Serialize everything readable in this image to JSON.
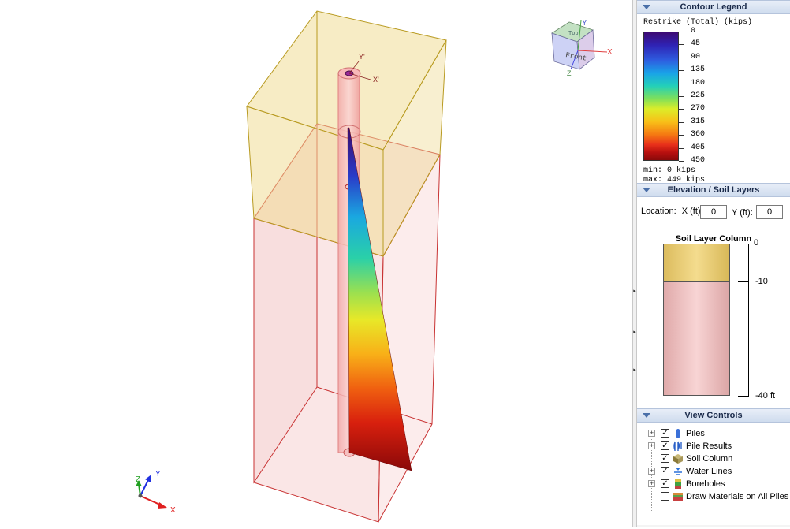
{
  "viewport": {
    "axis_labels": {
      "x": "X",
      "y": "Y",
      "z": "Z"
    },
    "pile_labels": {
      "x_prime": "X'",
      "y_prime": "Y'"
    },
    "view_cube": {
      "face": "Front",
      "top": "Top",
      "x": "X",
      "y": "Y",
      "z": "Z"
    },
    "colors": {
      "upper_soil": "#f0dc96",
      "lower_soil": "#f5c8c8",
      "pile": "#f4a0a0",
      "edge_upper": "#b89a20",
      "edge_lower": "#c83232"
    }
  },
  "contour_legend": {
    "header": "Contour Legend",
    "title": "Restrike (Total) (kips)",
    "ticks": [
      "0",
      "45",
      "90",
      "135",
      "180",
      "225",
      "270",
      "315",
      "360",
      "405",
      "450"
    ],
    "min_text": "min: 0 kips",
    "max_text": "max: 449 kips"
  },
  "elevation": {
    "header": "Elevation / Soil Layers",
    "location_label": "Location:",
    "x_label": "X (ft):",
    "x_value": "0",
    "y_label": "Y (ft):",
    "y_value": "0",
    "column_title": "Soil Layer Column",
    "axis_labels": [
      "0",
      "-10",
      "-40 ft"
    ],
    "layer_colors": [
      "#e8c96e",
      "#eebcbc"
    ]
  },
  "view_controls": {
    "header": "View Controls",
    "items": [
      {
        "label": "Piles",
        "checked": true,
        "expandable": true,
        "icon": "pile-icon"
      },
      {
        "label": "Pile Results",
        "checked": true,
        "expandable": true,
        "icon": "pile-results-icon"
      },
      {
        "label": "Soil Column",
        "checked": true,
        "expandable": false,
        "icon": "soil-column-icon"
      },
      {
        "label": "Water Lines",
        "checked": true,
        "expandable": true,
        "icon": "water-lines-icon"
      },
      {
        "label": "Boreholes",
        "checked": true,
        "expandable": true,
        "icon": "boreholes-icon"
      },
      {
        "label": "Draw Materials on All Piles",
        "checked": false,
        "expandable": false,
        "icon": "materials-icon"
      }
    ]
  }
}
